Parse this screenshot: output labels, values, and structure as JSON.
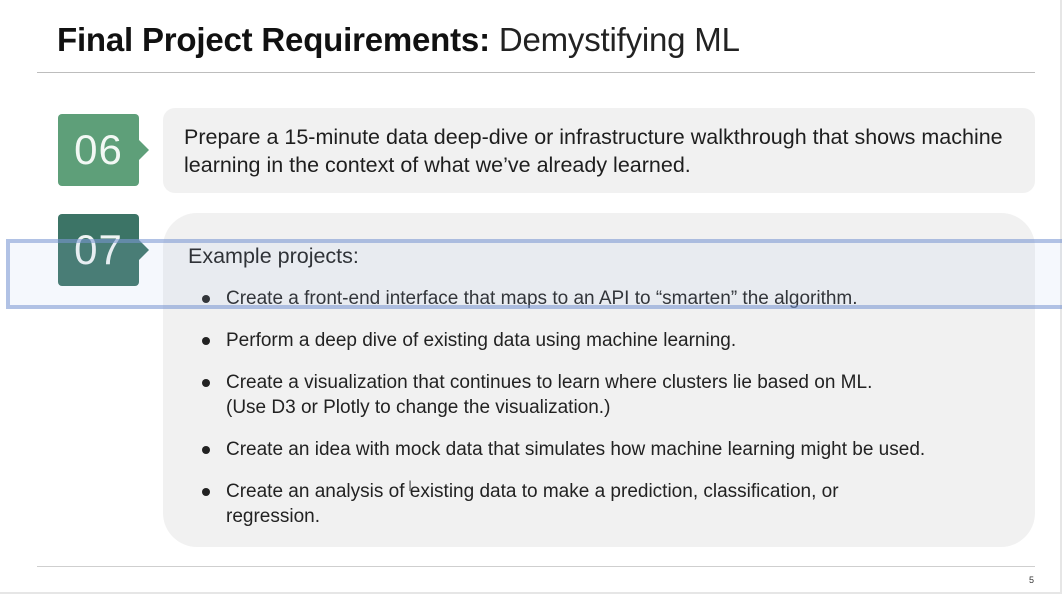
{
  "title": {
    "bold": "Final Project Requirements:",
    "light": "Demystifying ML"
  },
  "items": [
    {
      "number": "06",
      "text": "Prepare a 15-minute data deep-dive or infrastructure walkthrough that shows machine learning in the context of what we’ve already learned."
    },
    {
      "number": "07",
      "heading": "Example projects:",
      "bullets": [
        {
          "line1": "Create a front-end interface that maps to an API to “smarten” the algorithm.",
          "line2": ""
        },
        {
          "line1": "Perform a deep dive of existing data using machine learning.",
          "line2": ""
        },
        {
          "line1": "Create a visualization that continues to learn where clusters lie based on ML.",
          "line2": "(Use D3 or Plotly to change the visualization.)"
        },
        {
          "line1": "Create an idea with mock data that simulates how machine learning might be used.",
          "line2": ""
        },
        {
          "line1": "Create an analysis of existing data to make a prediction, classification, or",
          "line2": "regression."
        }
      ]
    }
  ],
  "slide_number": "5",
  "colors": {
    "num06": "#5e9f79",
    "num07": "#3c7466",
    "card": "#f1f1f1"
  },
  "cursor_icon": "text-cursor-icon"
}
